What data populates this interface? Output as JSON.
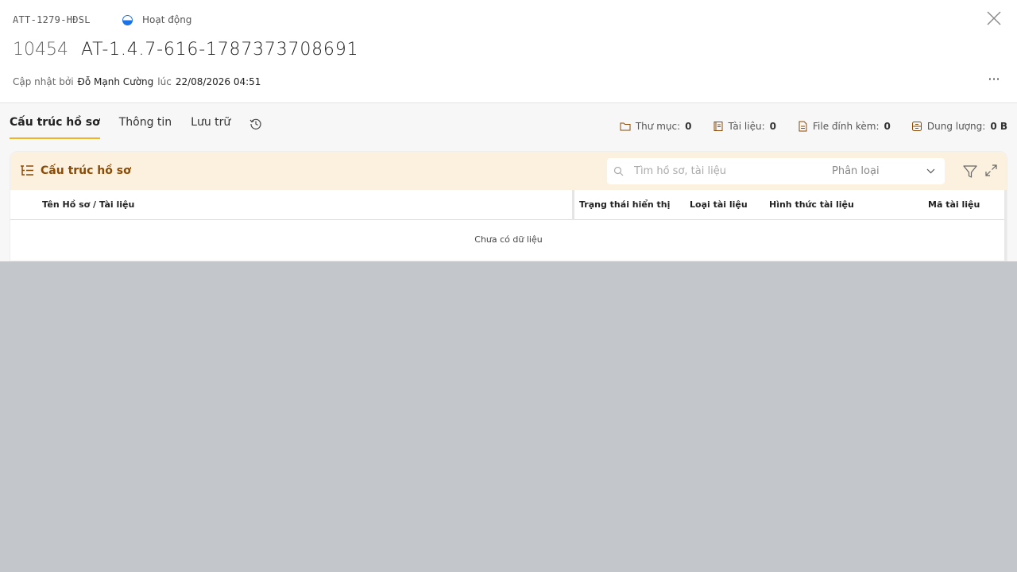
{
  "header": {
    "code": "ATT-1279-HĐSL",
    "status": "Hoạt động",
    "record_number": "10454",
    "record_name": "AT-1.4.7-616-1787373708691",
    "updated_by_label": "Cập nhật bởi",
    "updated_by": "Đỗ Mạnh Cường",
    "at_label": "lúc",
    "updated_at": "22/08/2026 04:51",
    "more_label": "···"
  },
  "tabs": [
    {
      "label": "Cấu trúc hồ sơ",
      "active": true
    },
    {
      "label": "Thông tin"
    },
    {
      "label": "Lưu trữ"
    }
  ],
  "stats": {
    "folders_label": "Thư mục:",
    "folders_value": "0",
    "documents_label": "Tài liệu:",
    "documents_value": "0",
    "attachments_label": "File đính kèm:",
    "attachments_value": "0",
    "size_label": "Dung lượng:",
    "size_value": "0 B"
  },
  "panel": {
    "title": "Cấu trúc hồ sơ",
    "search_placeholder": "Tìm hồ sơ, tài liệu",
    "classify_label": "Phân loại"
  },
  "table": {
    "columns": [
      "Tên Hồ sơ / Tài liệu",
      "Trạng thái hiển thị",
      "Loại tài liệu",
      "Hình thức tài liệu",
      "Mã tài liệu"
    ],
    "empty_text": "Chưa có dữ liệu"
  },
  "colors": {
    "accent": "#f0b429",
    "panel_title": "#8a4b06",
    "status_blue": "#1a73e8"
  }
}
